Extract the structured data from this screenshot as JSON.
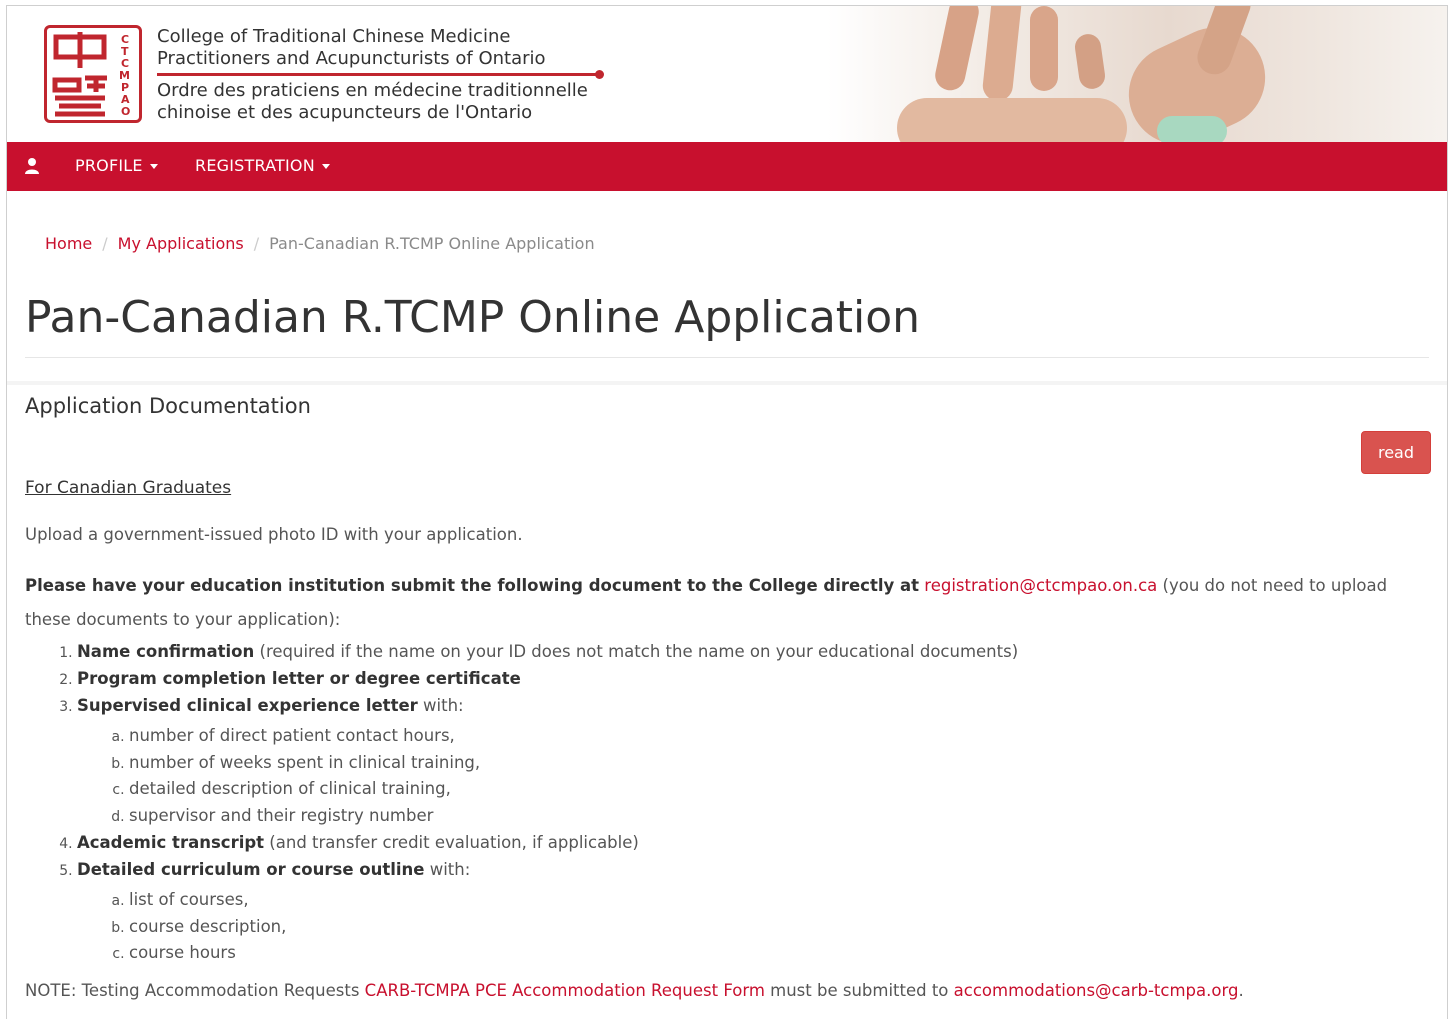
{
  "header": {
    "org_en_line1": "College of Traditional Chinese Medicine",
    "org_en_line2": "Practitioners and Acupuncturists of Ontario",
    "org_fr_line1": "Ordre des praticiens en médecine traditionnelle",
    "org_fr_line2": "chinoise et des acupuncteurs de l'Ontario",
    "logo_letters": [
      "C",
      "T",
      "C",
      "M",
      "P",
      "A",
      "O"
    ],
    "brand_color": "#c8102e"
  },
  "nav": {
    "user_icon": "user-icon",
    "profile_label": "PROFILE",
    "registration_label": "REGISTRATION"
  },
  "breadcrumb": {
    "home": "Home",
    "applications": "My Applications",
    "current": "Pan-Canadian R.TCMP Online Application"
  },
  "page": {
    "title": "Pan-Canadian R.TCMP Online Application",
    "section_title": "Application Documentation",
    "read_button": "read"
  },
  "content": {
    "subheading": "For Canadian Graduates",
    "upload_text": "Upload a government-issued photo ID with your application.",
    "institution_bold": "Please have your education institution submit the following document to the College directly at",
    "registration_email": "registration@ctcmpao.on.ca",
    "institution_tail": " (you do not need to upload these documents to your application):",
    "items": [
      {
        "bold": "Name confirmation",
        "rest": " (required if the name on your ID does not match the name on your educational documents)"
      },
      {
        "bold": "Program completion letter or degree certificate",
        "rest": ""
      },
      {
        "bold": "Supervised clinical experience letter",
        "rest": " with:",
        "sub": [
          "number of direct patient contact hours,",
          "number of weeks spent in clinical training,",
          "detailed description of clinical training,",
          "supervisor and their registry number"
        ]
      },
      {
        "bold": "Academic transcript",
        "rest": " (and transfer credit evaluation, if applicable)"
      },
      {
        "bold": "Detailed curriculum or course outline",
        "rest": " with:",
        "sub": [
          "list of courses,",
          "course description,",
          "course hours"
        ]
      }
    ],
    "note_prefix": "NOTE: Testing Accommodation Requests ",
    "note_link": "CARB-TCMPA PCE Accommodation Request Form",
    "note_middle": " must be submitted to ",
    "note_email": "accommodations@carb-tcmpa.org",
    "note_suffix": "."
  }
}
